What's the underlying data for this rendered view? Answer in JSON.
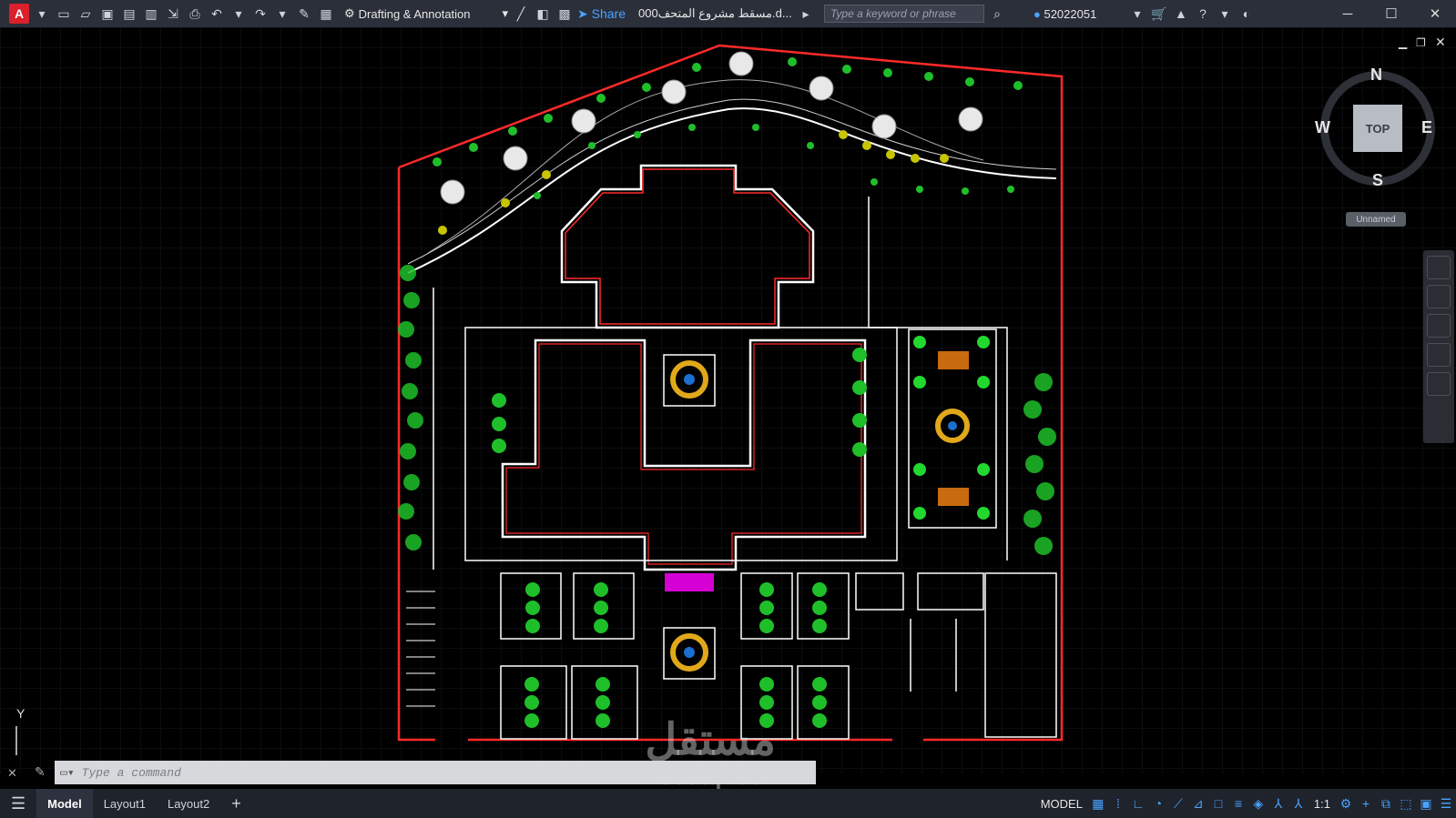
{
  "titlebar": {
    "app_letter": "A",
    "workspace": "Drafting & Annotation",
    "share_label": "Share",
    "doc_title": "000مسقط مشروع المتحف.d...",
    "search_placeholder": "Type a keyword or phrase",
    "user_id": "52022051"
  },
  "viewcube": {
    "north": "N",
    "south": "S",
    "east": "E",
    "west": "W",
    "face": "TOP",
    "ucs_label": "Unnamed"
  },
  "ucs": {
    "y_label": "Y"
  },
  "command_line": {
    "placeholder": "Type a command"
  },
  "tabs": [
    {
      "label": "Model",
      "active": true
    },
    {
      "label": "Layout1",
      "active": false
    },
    {
      "label": "Layout2",
      "active": false
    }
  ],
  "statusbar": {
    "model_label": "MODEL",
    "scale": "1:1"
  },
  "watermark": {
    "arabic": "مستقل",
    "latin": "mostaql.com"
  },
  "colors": {
    "titlebar_bg": "#2b2f3a",
    "canvas_bg": "#000000",
    "plan_boundary": "#ff2a2a",
    "plan_lines": "#ffffff",
    "vegetation": "#1fbf2a",
    "fountain": "#e0a81a",
    "accent_magenta": "#d400d4",
    "statusbar_bg": "#1f232c"
  }
}
